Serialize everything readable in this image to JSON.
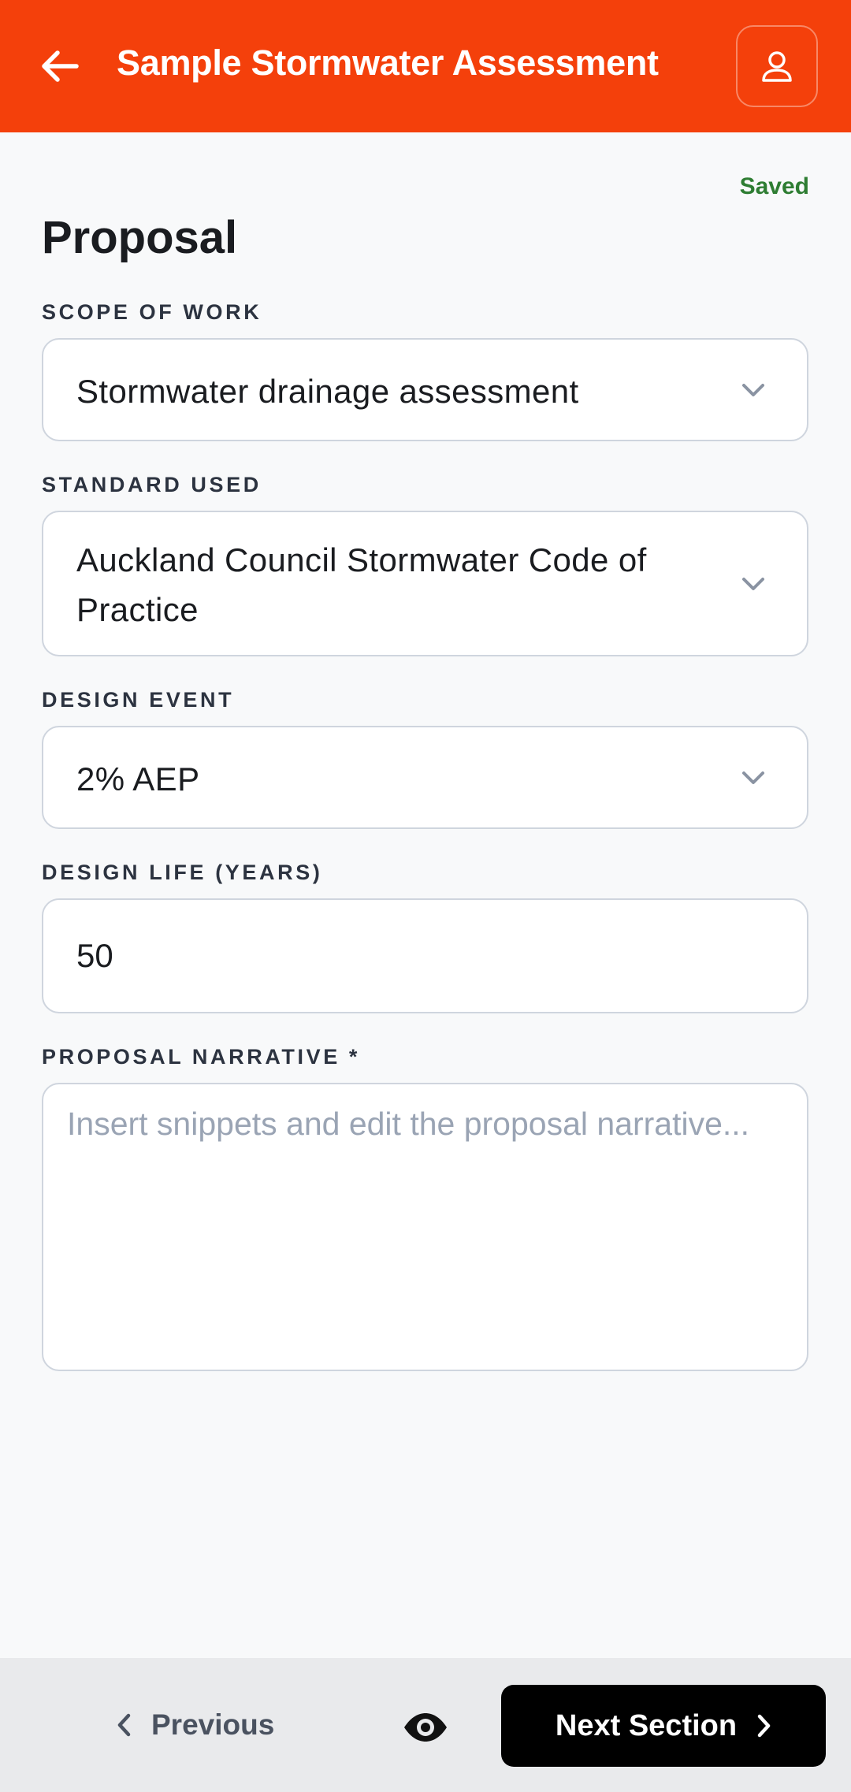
{
  "header": {
    "title": "Sample Stormwater Assessment",
    "accent_color": "#f4400b",
    "back_icon": "arrow-left-icon",
    "profile_icon": "user-icon"
  },
  "status": {
    "saved_label": "Saved",
    "saved_color": "#2e7d32"
  },
  "section": {
    "title": "Proposal"
  },
  "fields": {
    "scope_of_work": {
      "label": "SCOPE OF WORK",
      "value": "Stormwater drainage assessment"
    },
    "standard_used": {
      "label": "STANDARD USED",
      "value": "Auckland Council Stormwater Code of Practice"
    },
    "design_event": {
      "label": "DESIGN EVENT",
      "value": "2% AEP"
    },
    "design_life": {
      "label": "DESIGN LIFE (YEARS)",
      "value": "50"
    },
    "proposal_narrative": {
      "label": "PROPOSAL NARRATIVE *",
      "value": "",
      "placeholder": "Insert snippets and edit the proposal narrative..."
    }
  },
  "footer": {
    "previous_label": "Previous",
    "preview_icon": "eye-icon",
    "next_label": "Next Section"
  }
}
